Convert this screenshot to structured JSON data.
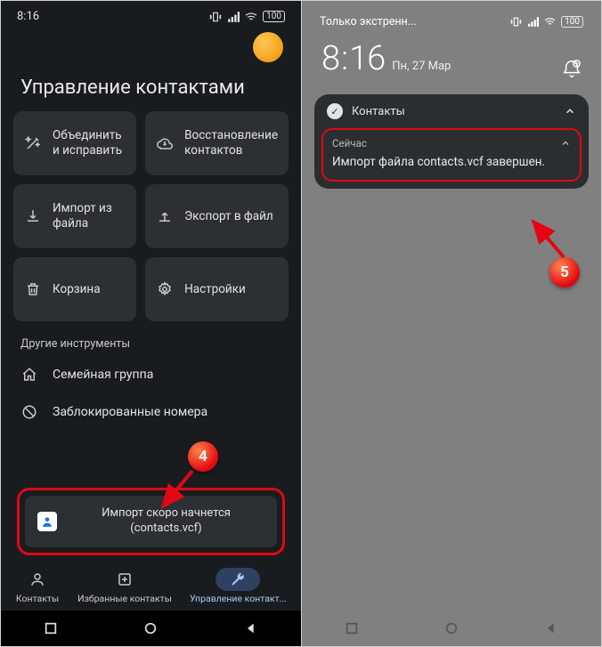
{
  "left": {
    "status": {
      "time": "8:16",
      "battery": "100"
    },
    "title": "Управление контактами",
    "tiles": [
      {
        "name": "merge-fix",
        "icon": "wand",
        "label": "Объединить и исправить"
      },
      {
        "name": "restore",
        "icon": "cloud",
        "label": "Восстановление контактов"
      },
      {
        "name": "import-file",
        "icon": "download",
        "label": "Импорт из файла"
      },
      {
        "name": "export-file",
        "icon": "upload",
        "label": "Экспорт в файл"
      },
      {
        "name": "trash",
        "icon": "trash",
        "label": "Корзина"
      },
      {
        "name": "settings",
        "icon": "gear",
        "label": "Настройки"
      }
    ],
    "section_label": "Другие инструменты",
    "rows": [
      {
        "name": "family-group",
        "icon": "home",
        "label": "Семейная группа"
      },
      {
        "name": "blocked-numbers",
        "icon": "block",
        "label": "Заблокированные номера"
      }
    ],
    "toast": {
      "line1": "Импорт скоро начнется",
      "line2": "(contacts.vcf)"
    },
    "callout": "4",
    "tabs": [
      {
        "name": "tab-contacts",
        "icon": "person",
        "label": "Контакты"
      },
      {
        "name": "tab-favorites",
        "icon": "addbox",
        "label": "Избранные контакты"
      },
      {
        "name": "tab-manage",
        "icon": "wrench",
        "label": "Управление контакт...",
        "active": true
      }
    ]
  },
  "right": {
    "status": {
      "carrier": "Только экстренн...",
      "battery": "100"
    },
    "clock": {
      "h": "8",
      "m": "16",
      "date": "Пн, 27 Мар"
    },
    "notif": {
      "app": "Контакты",
      "time": "Сейчас",
      "message": "Импорт файла contacts.vcf завершен."
    },
    "callout": "5"
  }
}
